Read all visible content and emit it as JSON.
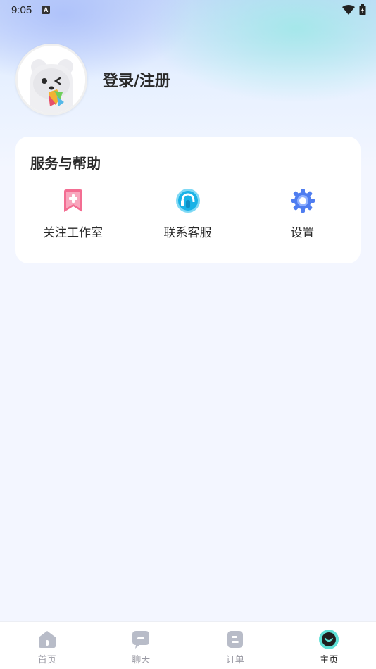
{
  "status_bar": {
    "time": "9:05",
    "notification_badge": "A"
  },
  "profile": {
    "login_label": "登录/注册",
    "avatar_icon": "panda-avatar-icon"
  },
  "services": {
    "title": "服务与帮助",
    "items": [
      {
        "label": "关注工作室",
        "icon": "bookmark-plus-icon",
        "color": "#f0688f"
      },
      {
        "label": "联系客服",
        "icon": "headset-icon",
        "color": "#19b6e8"
      },
      {
        "label": "设置",
        "icon": "gear-icon",
        "color": "#4f7df0"
      }
    ]
  },
  "tabbar": {
    "tabs": [
      {
        "label": "首页",
        "icon": "home-icon",
        "active": false
      },
      {
        "label": "聊天",
        "icon": "chat-icon",
        "active": false
      },
      {
        "label": "订单",
        "icon": "order-icon",
        "active": false
      },
      {
        "label": "主页",
        "icon": "profile-icon",
        "active": true
      }
    ]
  },
  "colors": {
    "background": "#f3f6ff",
    "card": "#ffffff",
    "tab_inactive": "#9a9aa4",
    "tab_active": "#1c1c1c",
    "accent_teal": "#5fe0d6"
  }
}
